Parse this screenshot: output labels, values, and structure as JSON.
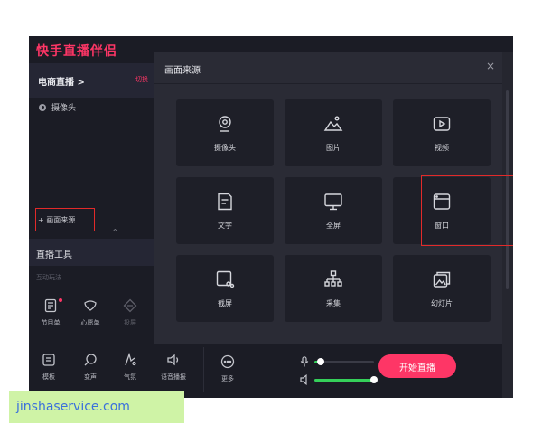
{
  "app": {
    "title": "快手直播伴侣"
  },
  "sidebar": {
    "channel": "电商直播 >",
    "switch_label": "切换",
    "sources": [
      {
        "label": "摄像头"
      }
    ],
    "add_source_label": "+ 画面来源",
    "collapse_glyph": "^"
  },
  "tools": {
    "title": "直播工具",
    "subtitle": "互动玩法",
    "row1": [
      {
        "label": "节目单",
        "icon": "program-list-icon"
      },
      {
        "label": "心愿单",
        "icon": "wishlist-icon"
      },
      {
        "label": "投屏",
        "icon": "cast-icon"
      }
    ],
    "row2": [
      {
        "label": "模板",
        "icon": "template-icon"
      },
      {
        "label": "变声",
        "icon": "voice-change-icon"
      },
      {
        "label": "气氛",
        "icon": "atmosphere-icon"
      },
      {
        "label": "语音播报",
        "icon": "voice-broadcast-icon"
      },
      {
        "label": "更多",
        "icon": "more-icon"
      }
    ]
  },
  "controls": {
    "mic_level": 0.1,
    "speaker_level": 1.0,
    "start_label": "开始直播"
  },
  "modal": {
    "title": "画面来源",
    "close_glyph": "×",
    "options": [
      {
        "label": "摄像头",
        "icon": "camera-icon"
      },
      {
        "label": "图片",
        "icon": "image-icon"
      },
      {
        "label": "视频",
        "icon": "video-icon"
      },
      {
        "label": "文字",
        "icon": "text-icon"
      },
      {
        "label": "全屏",
        "icon": "fullscreen-icon"
      },
      {
        "label": "窗口",
        "icon": "window-icon"
      },
      {
        "label": "截屏",
        "icon": "screenshot-icon"
      },
      {
        "label": "采集",
        "icon": "capture-icon"
      },
      {
        "label": "幻灯片",
        "icon": "slideshow-icon"
      }
    ]
  },
  "watermark": "jinshaservice.com",
  "colors": {
    "accent": "#fe3666",
    "highlight_box": "#e22a2a",
    "level_green": "#35d05a"
  }
}
